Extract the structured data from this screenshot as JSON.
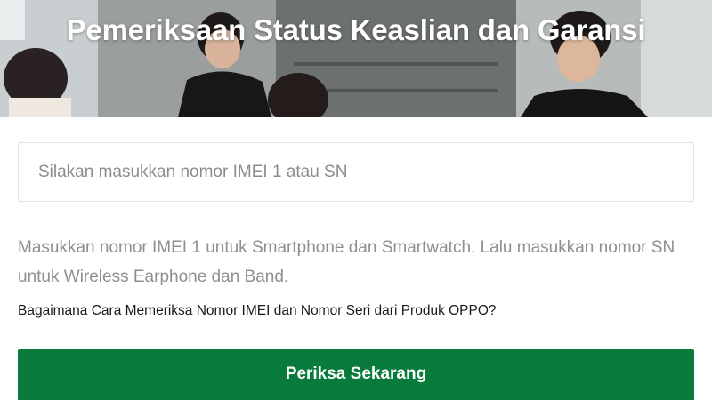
{
  "hero": {
    "title": "Pemeriksaan Status Keaslian dan Garansi"
  },
  "search": {
    "placeholder": "Silakan masukkan nomor IMEI 1 atau SN",
    "value": ""
  },
  "help_text": "Masukkan nomor IMEI 1 untuk Smartphone dan Smartwatch. Lalu masukkan nomor SN untuk Wireless Earphone dan Band.",
  "help_link": "Bagaimana Cara Memeriksa Nomor IMEI dan Nomor Seri dari Produk OPPO?",
  "submit": {
    "label": "Periksa Sekarang"
  },
  "colors": {
    "accent": "#087a3b",
    "muted_text": "#8f8f8f"
  }
}
